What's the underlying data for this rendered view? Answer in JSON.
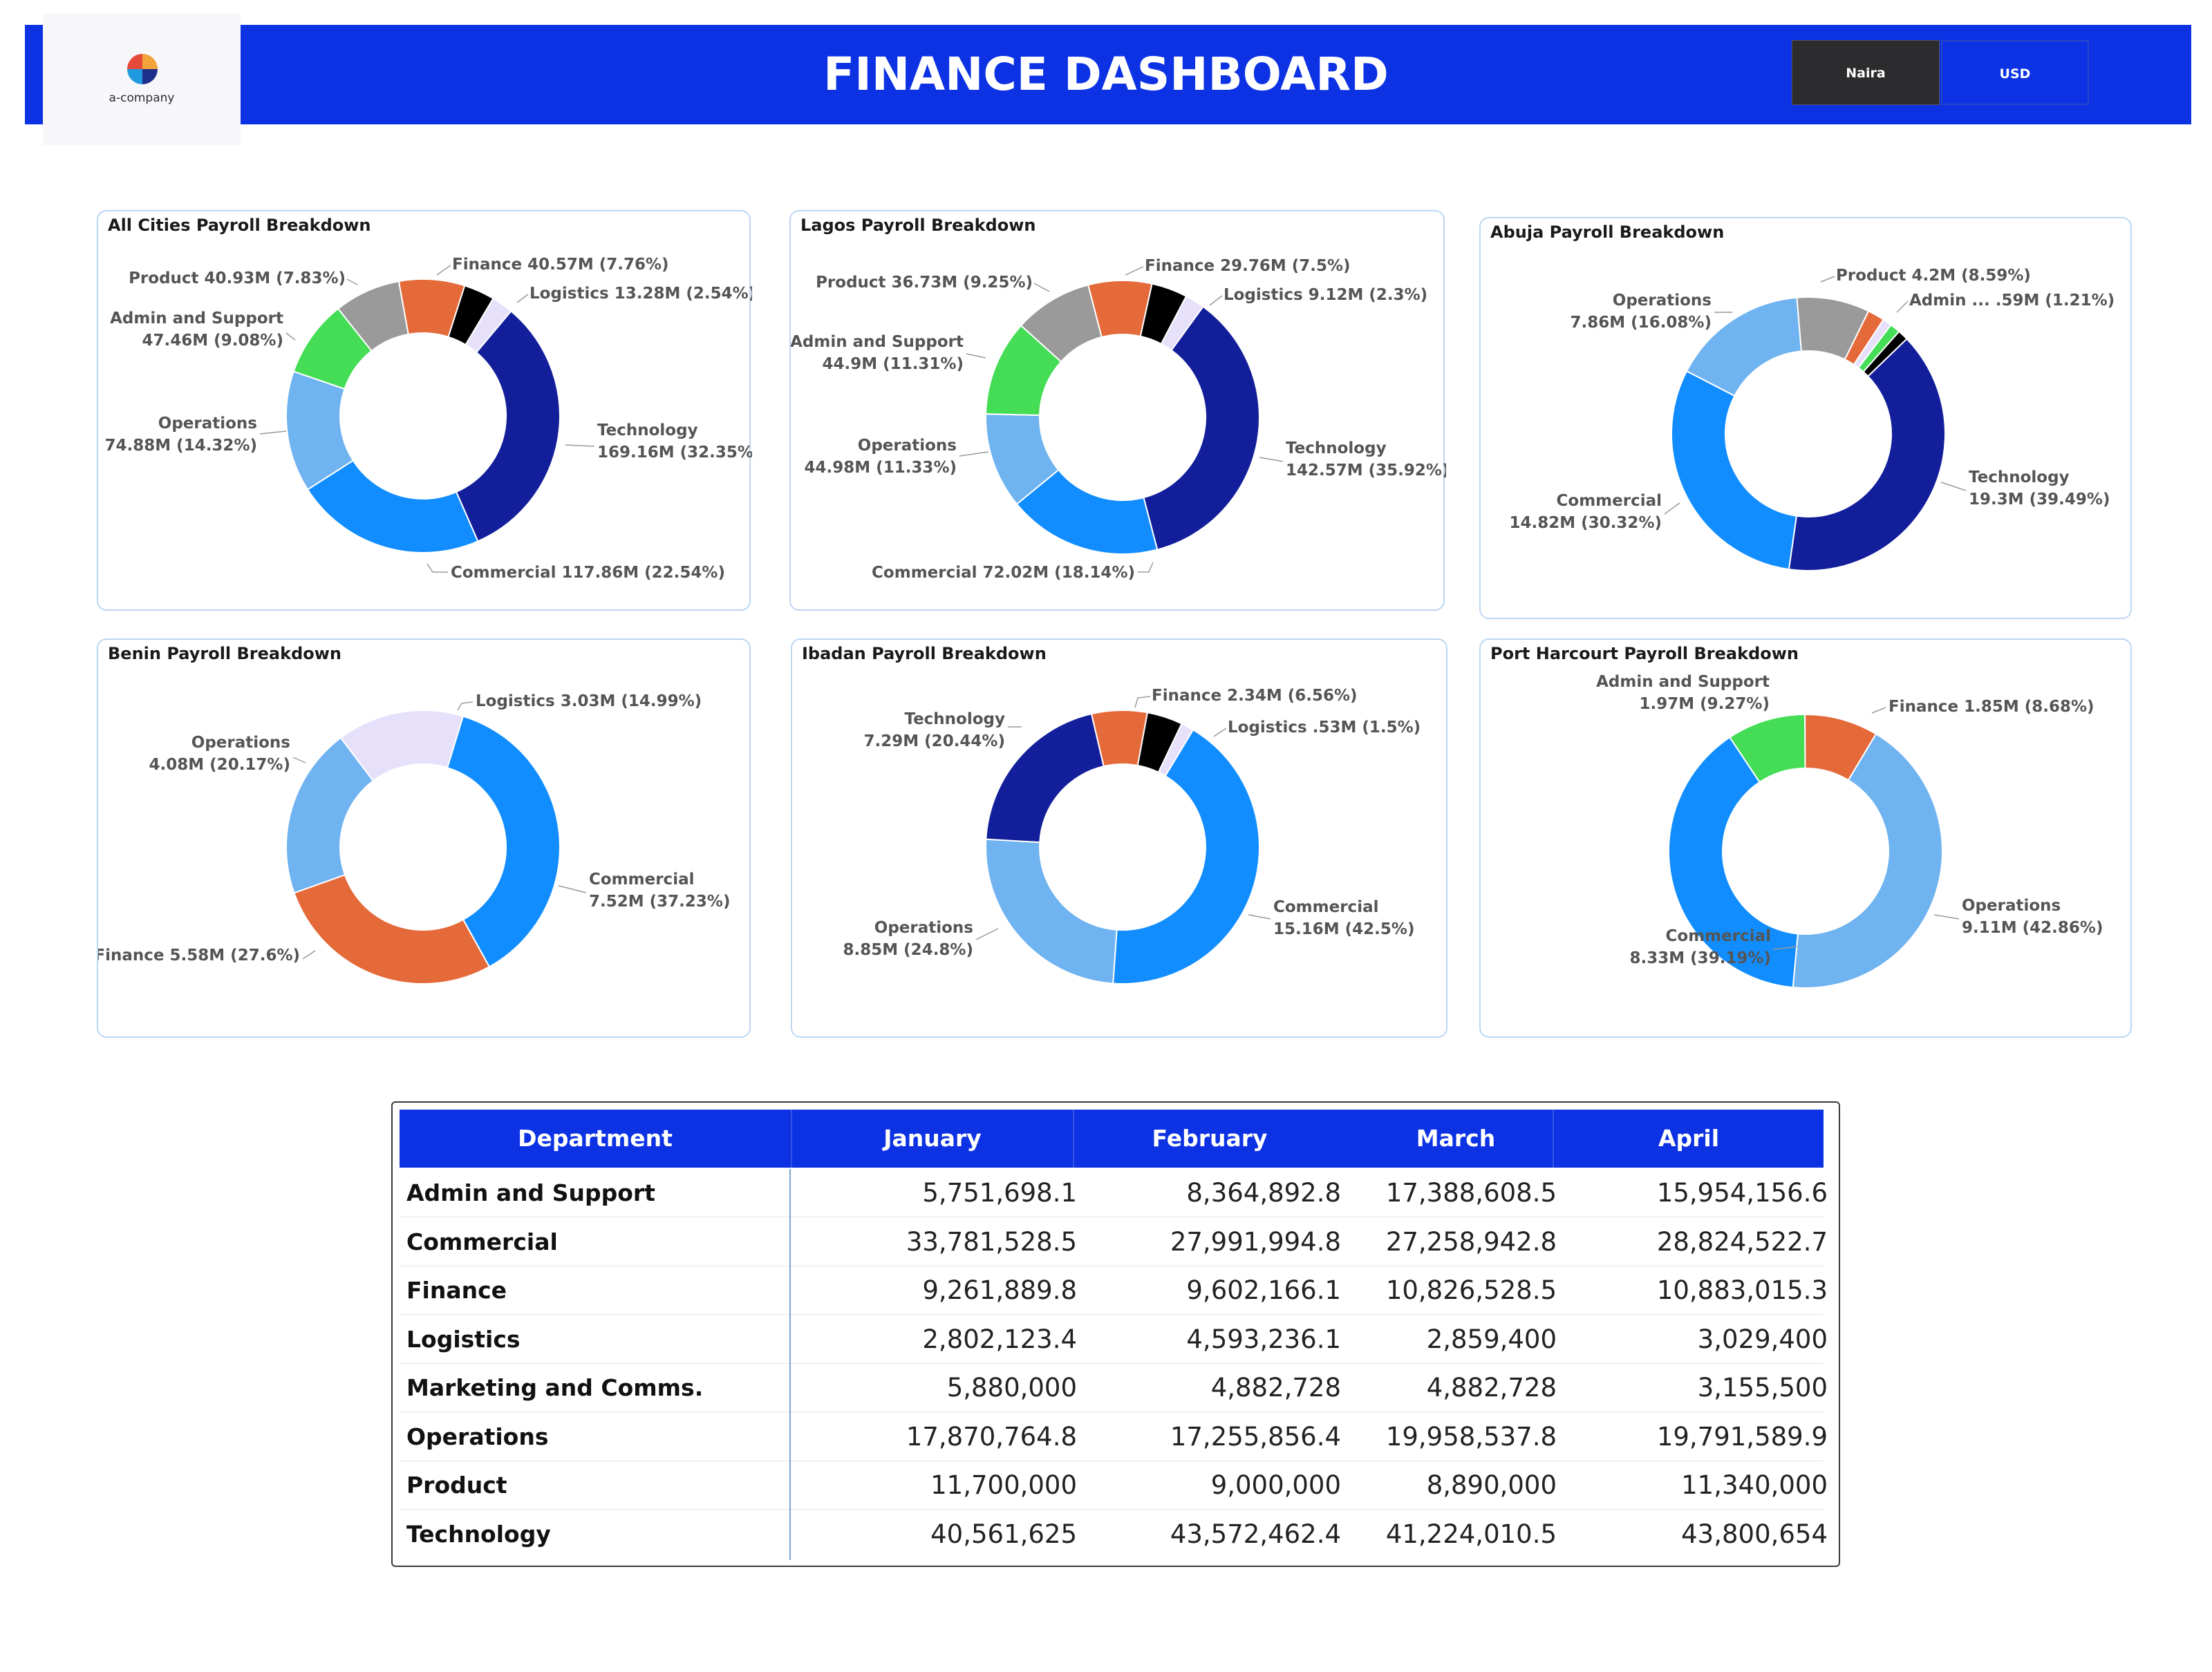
{
  "header": {
    "logo_text": "a-company",
    "title": "FINANCE DASHBOARD",
    "toggles": [
      "Naira",
      "USD"
    ],
    "active_toggle": "Naira"
  },
  "colors": {
    "banner": "#0c32e4",
    "technology": "#131f9a",
    "commercial": "#118dff",
    "operations": "#6fb3f0",
    "admin_support": "#44dd55",
    "product": "#9a9a9a",
    "finance": "#e56a3a",
    "marketing": "#000000",
    "logistics": "#e6e0fb"
  },
  "chart_data": [
    {
      "type": "pie",
      "title": "All Cities Payroll Breakdown",
      "slices": [
        {
          "category": "Technology",
          "value": 169.16,
          "percent": 32.35
        },
        {
          "category": "Commercial",
          "value": 117.86,
          "percent": 22.54
        },
        {
          "category": "Operations",
          "value": 74.88,
          "percent": 14.32
        },
        {
          "category": "Admin and Support",
          "value": 47.46,
          "percent": 9.08
        },
        {
          "category": "Product",
          "value": 40.93,
          "percent": 7.83
        },
        {
          "category": "Finance",
          "value": 40.57,
          "percent": 7.76
        },
        {
          "category": "Marketing and Comms.",
          "value": 19.09,
          "percent": 3.65
        },
        {
          "category": "Logistics",
          "value": 13.28,
          "percent": 2.54
        }
      ],
      "labels": [
        {
          "text": [
            "Product 40.93M (7.83%)"
          ]
        },
        {
          "text": [
            "Finance 40.57M (7.76%)"
          ]
        },
        {
          "text": [
            "Logistics 13.28M (2.54%)"
          ]
        },
        {
          "text": [
            "Admin and Support",
            "47.46M (9.08%)"
          ]
        },
        {
          "text": [
            "Technology",
            "169.16M (32.35%)"
          ]
        },
        {
          "text": [
            "Operations",
            "74.88M (14.32%)"
          ]
        },
        {
          "text": [
            "Commercial 117.86M (22.54%)"
          ]
        }
      ]
    },
    {
      "type": "pie",
      "title": "Lagos Payroll Breakdown",
      "slices": [
        {
          "category": "Technology",
          "value": 142.57,
          "percent": 35.92
        },
        {
          "category": "Commercial",
          "value": 72.02,
          "percent": 18.14
        },
        {
          "category": "Operations",
          "value": 44.98,
          "percent": 11.33
        },
        {
          "category": "Admin and Support",
          "value": 44.9,
          "percent": 11.31
        },
        {
          "category": "Product",
          "value": 36.73,
          "percent": 9.25
        },
        {
          "category": "Finance",
          "value": 29.76,
          "percent": 7.5
        },
        {
          "category": "Marketing and Comms.",
          "value": 16.3,
          "percent": 4.25
        },
        {
          "category": "Logistics",
          "value": 9.12,
          "percent": 2.3
        }
      ],
      "labels": [
        {
          "text": [
            "Finance 29.76M (7.5%)"
          ]
        },
        {
          "text": [
            "Product 36.73M (9.25%)"
          ]
        },
        {
          "text": [
            "Logistics 9.12M (2.3%)"
          ]
        },
        {
          "text": [
            "Admin and Support",
            "44.9M (11.31%)"
          ]
        },
        {
          "text": [
            "Technology",
            "142.57M (35.92%)"
          ]
        },
        {
          "text": [
            "Operations",
            "44.98M (11.33%)"
          ]
        },
        {
          "text": [
            "Commercial 72.02M (18.14%)"
          ]
        }
      ]
    },
    {
      "type": "pie",
      "title": "Abuja Payroll Breakdown",
      "slices": [
        {
          "category": "Technology",
          "value": 19.3,
          "percent": 39.49
        },
        {
          "category": "Commercial",
          "value": 14.82,
          "percent": 30.32
        },
        {
          "category": "Operations",
          "value": 7.86,
          "percent": 16.08
        },
        {
          "category": "Product",
          "value": 4.2,
          "percent": 8.59
        },
        {
          "category": "Finance",
          "value": 0.98,
          "percent": 2.0
        },
        {
          "category": "Logistics",
          "value": 0.52,
          "percent": 1.07
        },
        {
          "category": "Admin and Support",
          "value": 0.59,
          "percent": 1.21
        },
        {
          "category": "Marketing and Comms.",
          "value": 0.55,
          "percent": 1.24
        }
      ],
      "labels": [
        {
          "text": [
            "Product 4.2M (8.59%)"
          ]
        },
        {
          "text": [
            "Operations",
            "7.86M (16.08%)"
          ]
        },
        {
          "text": [
            "Admin ... .59M (1.21%)"
          ]
        },
        {
          "text": [
            "Technology",
            "19.3M (39.49%)"
          ]
        },
        {
          "text": [
            "Commercial",
            "14.82M (30.32%)"
          ]
        }
      ]
    },
    {
      "type": "pie",
      "title": "Benin Payroll Breakdown",
      "slices": [
        {
          "category": "Commercial",
          "value": 7.52,
          "percent": 37.23
        },
        {
          "category": "Finance",
          "value": 5.58,
          "percent": 27.6
        },
        {
          "category": "Operations",
          "value": 4.08,
          "percent": 20.17
        },
        {
          "category": "Logistics",
          "value": 3.03,
          "percent": 14.99
        }
      ],
      "labels": [
        {
          "text": [
            "Logistics 3.03M (14.99%)"
          ]
        },
        {
          "text": [
            "Operations",
            "4.08M (20.17%)"
          ]
        },
        {
          "text": [
            "Commercial",
            "7.52M (37.23%)"
          ]
        },
        {
          "text": [
            "Finance 5.58M (27.6%)"
          ]
        }
      ]
    },
    {
      "type": "pie",
      "title": "Ibadan Payroll Breakdown",
      "slices": [
        {
          "category": "Commercial",
          "value": 15.16,
          "percent": 42.5
        },
        {
          "category": "Operations",
          "value": 8.85,
          "percent": 24.8
        },
        {
          "category": "Technology",
          "value": 7.29,
          "percent": 20.44
        },
        {
          "category": "Finance",
          "value": 2.34,
          "percent": 6.56
        },
        {
          "category": "Marketing and Comms.",
          "value": 1.5,
          "percent": 4.2
        },
        {
          "category": "Logistics",
          "value": 0.53,
          "percent": 1.5
        }
      ],
      "labels": [
        {
          "text": [
            "Finance 2.34M (6.56%)"
          ]
        },
        {
          "text": [
            "Technology",
            "7.29M (20.44%)"
          ]
        },
        {
          "text": [
            "Logistics .53M (1.5%)"
          ]
        },
        {
          "text": [
            "Commercial",
            "15.16M (42.5%)"
          ]
        },
        {
          "text": [
            "Operations",
            "8.85M (24.8%)"
          ]
        }
      ]
    },
    {
      "type": "pie",
      "title": "Port Harcourt Payroll Breakdown",
      "slices": [
        {
          "category": "Operations",
          "value": 9.11,
          "percent": 42.86
        },
        {
          "category": "Commercial",
          "value": 8.33,
          "percent": 39.19
        },
        {
          "category": "Admin and Support",
          "value": 1.97,
          "percent": 9.27
        },
        {
          "category": "Finance",
          "value": 1.85,
          "percent": 8.68
        }
      ],
      "labels": [
        {
          "text": [
            "Admin and Support",
            "1.97M (9.27%)"
          ]
        },
        {
          "text": [
            "Finance 1.85M (8.68%)"
          ]
        },
        {
          "text": [
            "Operations",
            "9.11M (42.86%)"
          ]
        },
        {
          "text": [
            "Commercial",
            "8.33M (39.19%)"
          ]
        }
      ]
    }
  ],
  "table": {
    "columns": [
      "Department",
      "January",
      "February",
      "March",
      "April"
    ],
    "rows": [
      {
        "dept": "Admin and Support",
        "values": [
          "5,751,698.1",
          "8,364,892.8",
          "17,388,608.5",
          "15,954,156.6"
        ]
      },
      {
        "dept": "Commercial",
        "values": [
          "33,781,528.5",
          "27,991,994.8",
          "27,258,942.8",
          "28,824,522.7"
        ]
      },
      {
        "dept": "Finance",
        "values": [
          "9,261,889.8",
          "9,602,166.1",
          "10,826,528.5",
          "10,883,015.3"
        ]
      },
      {
        "dept": "Logistics",
        "values": [
          "2,802,123.4",
          "4,593,236.1",
          "2,859,400",
          "3,029,400"
        ]
      },
      {
        "dept": "Marketing and Comms.",
        "values": [
          "5,880,000",
          "4,882,728",
          "4,882,728",
          "3,155,500"
        ]
      },
      {
        "dept": "Operations",
        "values": [
          "17,870,764.8",
          "17,255,856.4",
          "19,958,537.8",
          "19,791,589.9"
        ]
      },
      {
        "dept": "Product",
        "values": [
          "11,700,000",
          "9,000,000",
          "8,890,000",
          "11,340,000"
        ]
      },
      {
        "dept": "Technology",
        "values": [
          "40,561,625",
          "43,572,462.4",
          "41,224,010.5",
          "43,800,654"
        ]
      }
    ]
  }
}
